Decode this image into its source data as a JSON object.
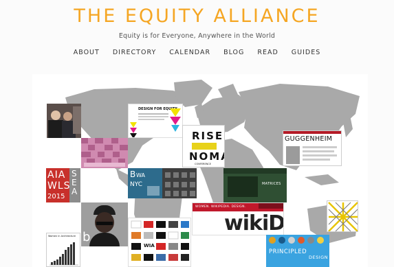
{
  "site": {
    "title": "THE EQUITY ALLIANCE",
    "tagline": "Equity is for Everyone, Anywhere in the World"
  },
  "nav": {
    "items": [
      "ABOUT",
      "DIRECTORY",
      "CALENDAR",
      "BLOG",
      "READ",
      "GUIDES"
    ]
  },
  "colors": {
    "accent": "#f5a623",
    "map_gray": "#a9a9a9",
    "panel": "#ffffff",
    "page_bg": "#fbfbfb"
  },
  "collage": {
    "design_for_equity": "DESIGN FOR EQUITY",
    "rise": "RISE",
    "noma": "NOMA",
    "noma_sub": "CONFERENCE",
    "guggenheim": "GUGGENHEIM",
    "aia": "AIA",
    "wls": "WLS",
    "year": "2015",
    "sea": "SEA",
    "bwa": "B",
    "bwa2": "WA",
    "nyc": "NYC",
    "matrices": "MATRICES",
    "wikid_top": "WOMEN. WIKIPEDIA. DESIGN.",
    "wikid": "wikiD",
    "principled": "PRINCIPLED",
    "design": "DESIGN",
    "women_in_arch": "Women in Architecture",
    "wia": "WIA",
    "b_letter": "b"
  }
}
